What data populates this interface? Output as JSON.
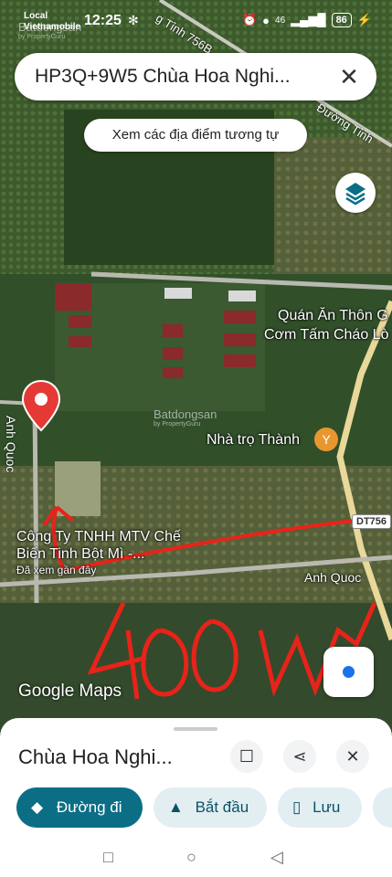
{
  "status": {
    "carrier_line1": "Local",
    "carrier_line2": "Vietnamobile",
    "time": "12:25",
    "network": "46",
    "battery": "86"
  },
  "search": {
    "query": "HP3Q+9W5 Chùa Hoa Nghi...",
    "close_icon": "close-icon"
  },
  "similar_places_chip": "Xem các địa điểm tương tự",
  "map": {
    "road_top": "g Tỉnh 756B",
    "road_right": "Đường Tỉnh",
    "poi_quan_line1": "Quán Ăn Thôn G",
    "poi_quan_line2": "Cơm Tấm Cháo Lò",
    "poi_nha_tro": "Nhà trọ Thành",
    "road_dt": "DT756",
    "road_pin": "Anh Quoc",
    "road_bottom": "Anh Quoc",
    "company_line1": "Công Ty TNHH MTV Chế",
    "company_line2": "Biến Tinh Bột Mì -...",
    "company_note": "Đã xem gần đây",
    "handwritten": "400m",
    "watermark": "Batdongsan",
    "watermark_sub": "by PropertyGuru",
    "logo": "Google Maps"
  },
  "sheet": {
    "title": "Chùa Hoa Nghi...",
    "actions": [
      {
        "label": "Đường đi",
        "icon": "directions-icon"
      },
      {
        "label": "Bắt đầu",
        "icon": "navigation-icon"
      },
      {
        "label": "Lưu",
        "icon": "bookmark-icon"
      }
    ]
  },
  "colors": {
    "primary": "#0b6e85",
    "pin": "#e53935",
    "annotation": "#e8231a"
  }
}
